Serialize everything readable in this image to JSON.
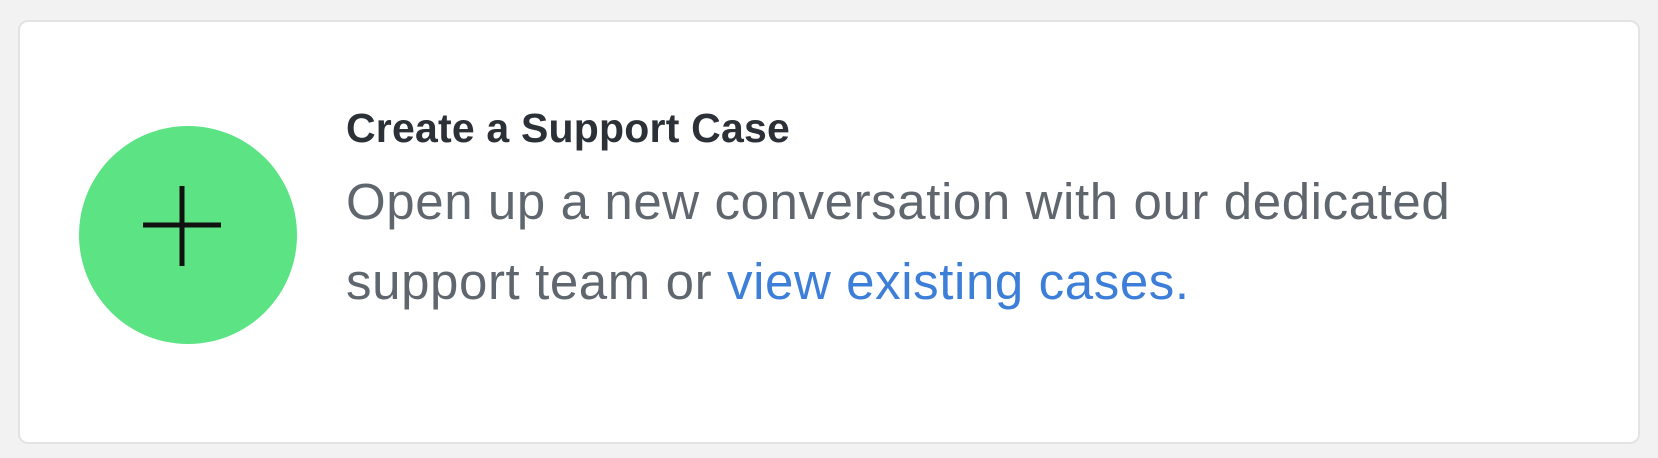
{
  "card": {
    "icon": "plus-icon",
    "icon_bg_color": "#5be384",
    "title": "Create a Support Case",
    "description": "Open up a new conversation with our dedicated support team or",
    "link_text": "view existing cases.",
    "link_color": "#3d7fd8"
  }
}
